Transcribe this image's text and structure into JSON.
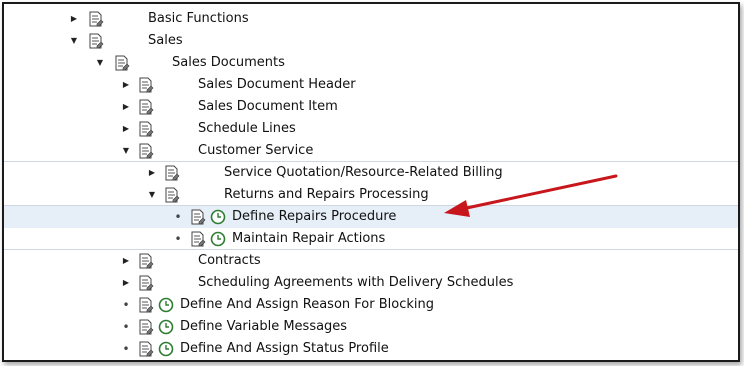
{
  "tree": {
    "basic_functions": "Basic Functions",
    "sales": "Sales",
    "sales_documents": "Sales Documents",
    "sales_document_header": "Sales Document Header",
    "sales_document_item": "Sales Document Item",
    "schedule_lines": "Schedule Lines",
    "customer_service": "Customer Service",
    "service_quotation": "Service Quotation/Resource-Related Billing",
    "returns_repairs": "Returns and Repairs Processing",
    "define_repairs_procedure": "Define Repairs Procedure",
    "maintain_repair_actions": "Maintain Repair Actions",
    "contracts": "Contracts",
    "scheduling_agreements": "Scheduling Agreements with Delivery Schedules",
    "define_assign_reason_blocking": "Define And Assign Reason For Blocking",
    "define_variable_messages": "Define Variable Messages",
    "define_assign_status_profile": "Define And Assign Status Profile"
  },
  "colors": {
    "highlight_row": "#e6eef8",
    "annotation_arrow": "#c8171c",
    "clock_icon": "#2e7d32"
  }
}
